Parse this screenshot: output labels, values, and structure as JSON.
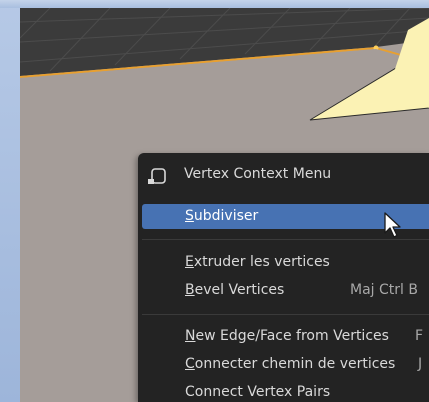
{
  "menu": {
    "title": "Vertex Context Menu",
    "items": [
      {
        "label_first": "S",
        "label_rest": "ubdiviser",
        "shortcut": "",
        "active": true
      },
      {
        "label_first": "E",
        "label_rest": "xtruder les vertices",
        "shortcut": ""
      },
      {
        "label_first": "B",
        "label_rest": "evel Vertices",
        "shortcut": "Maj Ctrl B"
      },
      {
        "label_first": "N",
        "label_rest": "ew Edge/Face from Vertices",
        "shortcut": "F"
      },
      {
        "label_first": "C",
        "label_rest": "onnecter chemin de vertices",
        "shortcut": "J"
      },
      {
        "label_first": "",
        "label_rest": "Connect Vertex Pairs",
        "shortcut": ""
      }
    ]
  },
  "colors": {
    "menu_bg": "#232323",
    "highlight": "#4772b3",
    "mesh_edge": "#e8a030",
    "tooltip_fill": "#fbf2b4"
  }
}
